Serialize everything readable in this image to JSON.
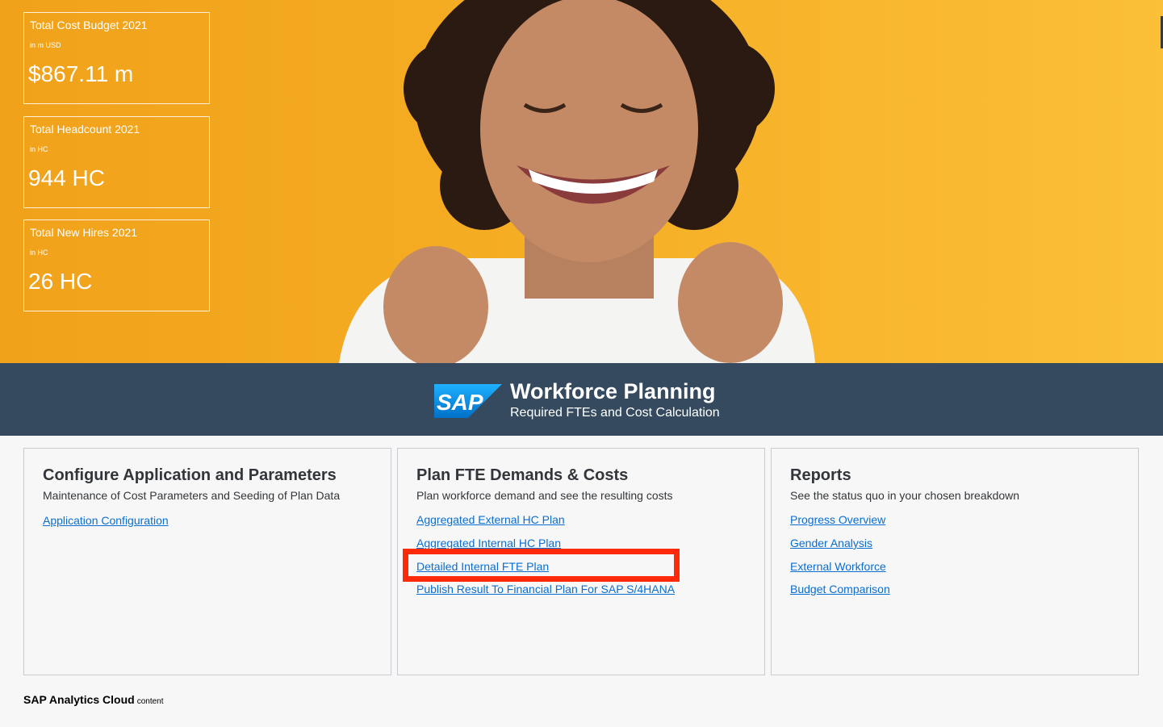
{
  "kpis": [
    {
      "title": "Total Cost Budget 2021",
      "unit": "in m USD",
      "value": "$867.11 m"
    },
    {
      "title": "Total Headcount 2021",
      "unit": "in HC",
      "value": "944 HC"
    },
    {
      "title": "Total New Hires 2021",
      "unit": "in HC",
      "value": "26 HC"
    }
  ],
  "banner": {
    "logo_text": "SAP",
    "title": "Workforce Planning",
    "subtitle": "Required FTEs and Cost Calculation"
  },
  "cards": [
    {
      "title": "Configure Application and Parameters",
      "description": "Maintenance of Cost Parameters and Seeding of Plan Data",
      "links": [
        "Application Configuration"
      ]
    },
    {
      "title": "Plan FTE Demands & Costs",
      "description": "Plan workforce demand and see the resulting costs",
      "links": [
        "Aggregated External HC Plan",
        "Aggregated Internal HC Plan",
        "Detailed Internal FTE Plan",
        "Publish Result To Financial Plan For SAP S/4HANA"
      ]
    },
    {
      "title": "Reports",
      "description": "See the status quo in your chosen breakdown",
      "links": [
        "Progress Overview",
        "Gender Analysis",
        "External Workforce",
        "Budget Comparison"
      ]
    }
  ],
  "footer": {
    "brand": "SAP Analytics Cloud",
    "suffix": "content"
  },
  "colors": {
    "hero": "#f5ad23",
    "banner": "#354a5f",
    "link": "#0a6ed1",
    "highlight": "#ff2a0a"
  }
}
